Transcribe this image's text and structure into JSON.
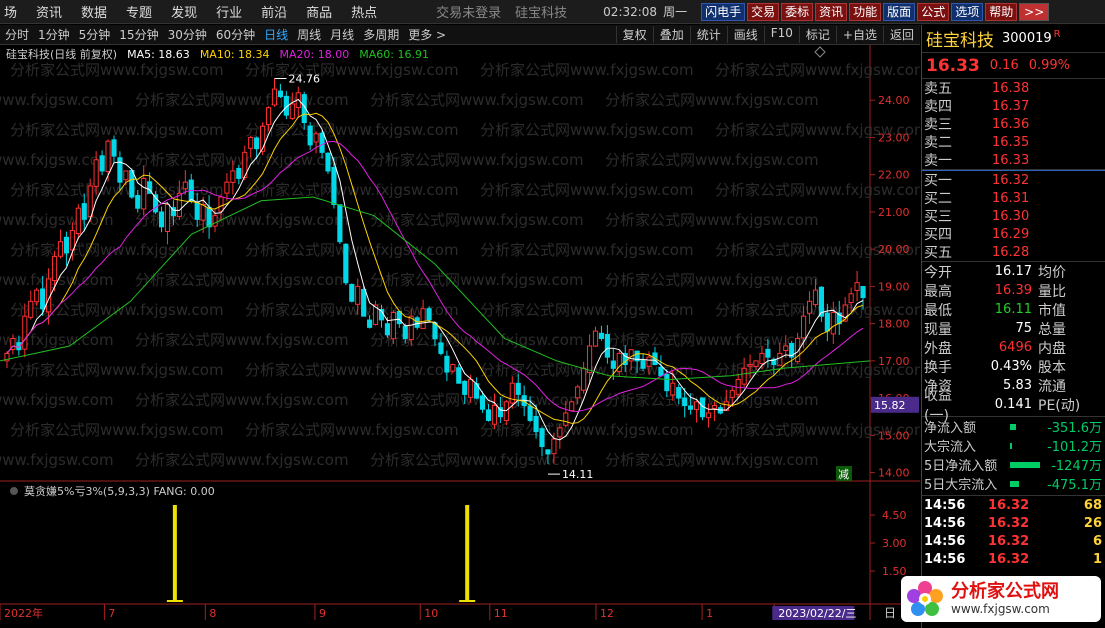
{
  "menu": {
    "items": [
      "场",
      "资讯",
      "数据",
      "专题",
      "发现",
      "行业",
      "前沿",
      "商品",
      "热点"
    ],
    "window_title": "交易未登录",
    "stock_title": "硅宝科技",
    "clock": "02:32:08",
    "weekday": "周一",
    "tools": [
      {
        "label": "闪电手",
        "style": "blue"
      },
      {
        "label": "交易",
        "style": "red"
      },
      {
        "label": "委标",
        "style": "red"
      },
      {
        "label": "资讯",
        "style": "red"
      },
      {
        "label": "功能",
        "style": "red"
      },
      {
        "label": "版面",
        "style": "blue"
      },
      {
        "label": "公式",
        "style": "red"
      },
      {
        "label": "选项",
        "style": "blue"
      },
      {
        "label": "帮助",
        "style": "red"
      }
    ],
    "more": ">>"
  },
  "periods": {
    "items": [
      "分时",
      "1分钟",
      "5分钟",
      "15分钟",
      "30分钟",
      "60分钟",
      "日线",
      "周线",
      "月线",
      "多周期",
      "更多 >"
    ],
    "active": "日线",
    "tools": [
      "复权",
      "叠加",
      "统计",
      "画线",
      "F10",
      "标记",
      "+自选",
      "返回"
    ]
  },
  "legend": {
    "stock": "硅宝科技(日线 前复权)",
    "ma5_label": "MA5: 18.63",
    "ma10_label": "MA10: 18.34",
    "ma20_label": "MA20: 18.00",
    "ma60_label": "MA60: 16.91",
    "colors": {
      "ma5": "#ffffff",
      "ma10": "#ffd200",
      "ma20": "#e020e0",
      "ma60": "#20c020",
      "up": "#ff3030",
      "down": "#00d8e8"
    }
  },
  "indicator": {
    "label": "莫贪嫌5%亏3%(5,9,3,3)  FANG: 0.00"
  },
  "watermark": "分析家公式网www.fxjgsw.com",
  "chart_data": {
    "type": "candlestick",
    "ylim": [
      13.8,
      25.0
    ],
    "yticks": [
      24.0,
      23.0,
      22.0,
      21.0,
      20.0,
      19.0,
      18.0,
      17.0,
      16.0,
      15.0,
      14.0
    ],
    "high_label": "24.76",
    "low_label": "14.11",
    "current_price_label": "15.82",
    "reduce_marker": "减",
    "x_axis_labels": [
      "2022年",
      "7",
      "8",
      "9",
      "10",
      "11",
      "12",
      "1",
      "2023/02/22/三"
    ],
    "daily_closes": [
      17.2,
      17.6,
      17.3,
      18.2,
      18.6,
      18.9,
      18.4,
      19.2,
      19.8,
      20.2,
      19.9,
      20.5,
      21.1,
      20.8,
      21.7,
      22.4,
      22.1,
      22.9,
      22.5,
      21.8,
      22.1,
      21.4,
      21.1,
      21.9,
      21.5,
      21.0,
      20.6,
      21.2,
      20.9,
      21.5,
      21.8,
      21.3,
      20.8,
      21.2,
      20.6,
      20.9,
      21.4,
      21.8,
      22.1,
      21.9,
      22.6,
      23.0,
      22.7,
      23.3,
      23.8,
      24.3,
      24.1,
      23.6,
      23.9,
      24.2,
      23.4,
      22.8,
      23.1,
      22.6,
      22.1,
      21.2,
      20.2,
      19.1,
      18.6,
      19.0,
      18.2,
      17.9,
      18.5,
      18.1,
      17.7,
      18.3,
      18.0,
      17.6,
      18.2,
      17.9,
      18.4,
      18.1,
      17.6,
      17.2,
      16.7,
      16.9,
      16.4,
      16.1,
      16.5,
      16.0,
      15.7,
      15.4,
      15.8,
      15.5,
      15.9,
      16.4,
      16.1,
      15.8,
      15.4,
      15.1,
      14.7,
      14.5,
      14.9,
      15.2,
      15.6,
      15.9,
      16.3,
      16.8,
      17.4,
      17.8,
      17.6,
      17.1,
      16.8,
      17.2,
      16.9,
      17.3,
      17.0,
      16.8,
      17.1,
      16.9,
      16.6,
      16.2,
      16.4,
      16.0,
      15.8,
      15.7,
      15.9,
      15.5,
      15.6,
      15.8,
      15.6,
      15.9,
      16.2,
      16.5,
      16.8,
      16.9,
      17.0,
      17.2,
      17.1,
      16.9,
      17.2,
      17.4,
      17.1,
      17.6,
      18.2,
      18.6,
      18.9,
      18.2,
      17.8,
      18.3,
      18.0,
      18.5,
      18.8,
      19.1,
      18.7
    ],
    "ma60_points": [
      [
        0,
        17.0
      ],
      [
        0.08,
        17.4
      ],
      [
        0.15,
        18.6
      ],
      [
        0.22,
        20.4
      ],
      [
        0.3,
        21.3
      ],
      [
        0.36,
        21.4
      ],
      [
        0.43,
        20.9
      ],
      [
        0.5,
        19.6
      ],
      [
        0.58,
        17.6
      ],
      [
        0.64,
        17.0
      ],
      [
        0.7,
        16.6
      ],
      [
        0.77,
        16.5
      ],
      [
        0.84,
        16.6
      ],
      [
        0.9,
        16.8
      ],
      [
        1.0,
        17.0
      ]
    ],
    "signal_spikes": [
      0.201,
      0.537
    ],
    "indicator_yticks": [
      "4.50",
      "3.00",
      "1.50"
    ]
  },
  "quote": {
    "name": "硅宝科技",
    "code": "300019",
    "suffix": "R",
    "price": "16.33",
    "change": "0.16",
    "pct": "0.99%",
    "asks": [
      {
        "label": "卖五",
        "price": "16.38"
      },
      {
        "label": "卖四",
        "price": "16.37"
      },
      {
        "label": "卖三",
        "price": "16.36"
      },
      {
        "label": "卖二",
        "price": "16.35"
      },
      {
        "label": "卖一",
        "price": "16.33"
      }
    ],
    "bids": [
      {
        "label": "买一",
        "price": "16.32"
      },
      {
        "label": "买二",
        "price": "16.31"
      },
      {
        "label": "买三",
        "price": "16.30"
      },
      {
        "label": "买四",
        "price": "16.29"
      },
      {
        "label": "买五",
        "price": "16.28"
      }
    ],
    "stats": [
      {
        "k": "今开",
        "v": "16.17",
        "c": "#ffffff",
        "k2": "均价"
      },
      {
        "k": "最高",
        "v": "16.39",
        "c": "#ff3030",
        "k2": "量比"
      },
      {
        "k": "最低",
        "v": "16.11",
        "c": "#20d020",
        "k2": "市值"
      },
      {
        "k": "现量",
        "v": "75",
        "c": "#ffffff",
        "k2": "总量"
      },
      {
        "k": "外盘",
        "v": "6496",
        "c": "#ff3030",
        "k2": "内盘"
      },
      {
        "k": "换手",
        "v": "0.43%",
        "c": "#ffffff",
        "k2": "股本"
      },
      {
        "k": "净资",
        "v": "5.83",
        "c": "#ffffff",
        "k2": "流通"
      },
      {
        "k": "收益(一)",
        "v": "0.141",
        "c": "#ffffff",
        "k2": "PE(动)"
      }
    ],
    "cashflow": [
      {
        "k": "净流入额",
        "v": "-351.6万",
        "bar": 0.2
      },
      {
        "k": "大宗流入",
        "v": "-101.2万",
        "bar": 0.05
      },
      {
        "k": "5日净流入额",
        "v": "-1247万",
        "bar": 1.0
      },
      {
        "k": "5日大宗流入",
        "v": "-475.1万",
        "bar": 0.3
      }
    ],
    "ticks": [
      {
        "t": "14:56",
        "p": "16.32",
        "n": "68"
      },
      {
        "t": "14:56",
        "p": "16.32",
        "n": "26"
      },
      {
        "t": "14:56",
        "p": "16.32",
        "n": "6"
      },
      {
        "t": "14:56",
        "p": "16.32",
        "n": "1"
      }
    ]
  },
  "logo": {
    "title": "分析家公式网",
    "url": "www.fxjgsw.com"
  },
  "corner": "日"
}
